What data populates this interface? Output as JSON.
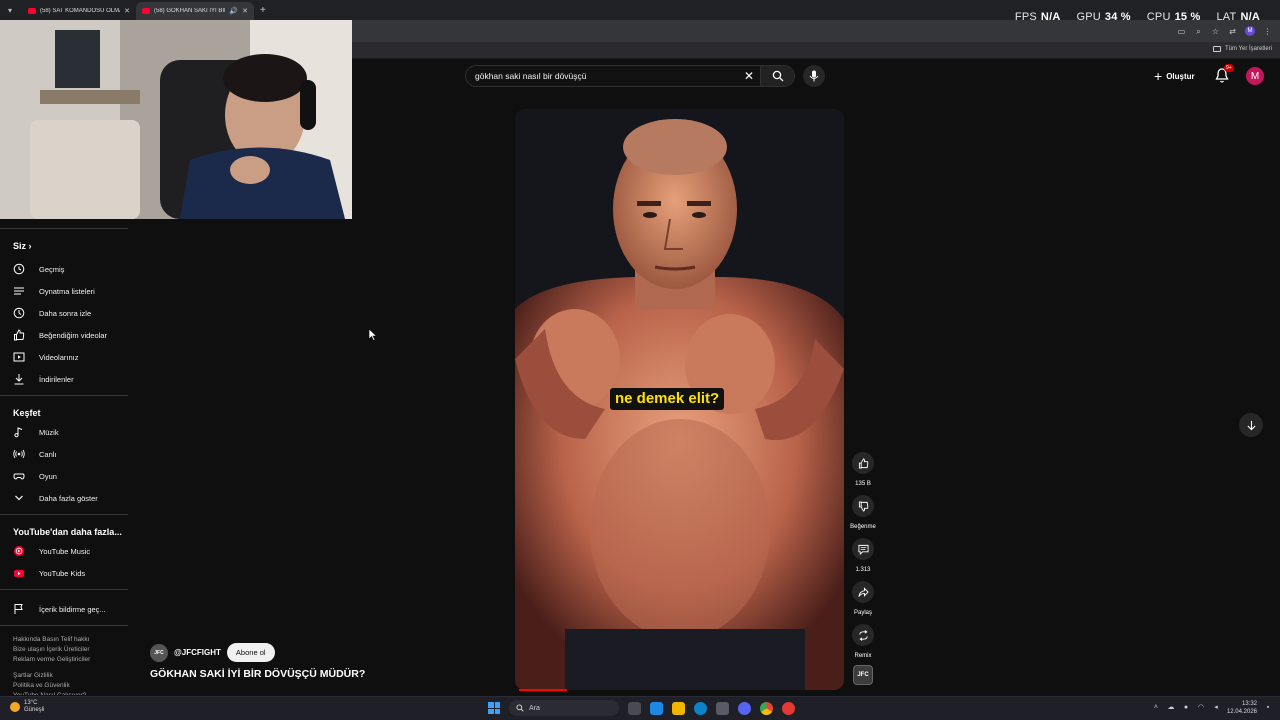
{
  "browser": {
    "tabs": [
      {
        "title": "(58) SAT KOMANDOSU OLMAK",
        "active": false
      },
      {
        "title": "(58) GÖKHAN SAKİ İYİ BİR D",
        "active": true
      }
    ],
    "bookmarks_all_label": "Tüm Yer İşaretleri",
    "profile_initial": "M"
  },
  "overlay": {
    "fps_label": "FPS",
    "fps_value": "N/A",
    "gpu_label": "GPU",
    "gpu_value": "34 %",
    "cpu_label": "CPU",
    "cpu_value": "15 %",
    "lat_label": "LAT",
    "lat_value": "N/A"
  },
  "header": {
    "search_value": "gökhan saki nasıl bir dövüşçü",
    "create_label": "Oluştur",
    "notification_badge": "9+",
    "avatar_initial": "M"
  },
  "sidebar": {
    "you_title": "Siz",
    "you_items": [
      {
        "label": "Geçmiş",
        "icon": "history-icon"
      },
      {
        "label": "Oynatma listeleri",
        "icon": "playlist-icon"
      },
      {
        "label": "Daha sonra izle",
        "icon": "clock-icon"
      },
      {
        "label": "Beğendiğim videolar",
        "icon": "like-icon"
      },
      {
        "label": "Videolarınız",
        "icon": "video-icon"
      },
      {
        "label": "İndirilenler",
        "icon": "download-icon"
      }
    ],
    "explore_title": "Keşfet",
    "explore_items": [
      {
        "label": "Müzik",
        "icon": "music-icon"
      },
      {
        "label": "Canlı",
        "icon": "live-icon"
      },
      {
        "label": "Oyun",
        "icon": "gaming-icon"
      },
      {
        "label": "Daha fazla göster",
        "icon": "chevron-down-icon"
      }
    ],
    "more_title": "YouTube'dan daha fazla...",
    "more_items": [
      {
        "label": "YouTube Music",
        "icon": "youtube-music-icon"
      },
      {
        "label": "YouTube Kids",
        "icon": "youtube-kids-icon"
      }
    ],
    "report_label": "İçerik bildirme geç...",
    "footer_lines": [
      "Hakkında  Basın  Telif hakkı",
      "Bize ulaşın  İçerik Üreticiler",
      "Reklam verme  Geliştiriciler",
      "",
      "Şartlar  Gizlilik",
      "Politika ve Güvenlik",
      "YouTube Nasıl Çalışıyor?"
    ]
  },
  "short": {
    "caption": "ne demek elit?",
    "progress_fraction": 0.15,
    "likes": "135 B",
    "dislike_label": "Beğenme",
    "comments": "1.313",
    "share_label": "Paylaş",
    "remix_label": "Remix",
    "channel_handle": "@JFCFIGHT",
    "channel_avatar_text": "JFC",
    "subscribe_label": "Abone ol",
    "title": "GÖKHAN SAKİ İYİ BİR DÖVÜŞÇÜ MÜDÜR?"
  },
  "taskbar": {
    "weather_temp": "13°C",
    "weather_desc": "Güneşli",
    "search_placeholder": "Ara",
    "time": "13:32",
    "date": "12.04.2026"
  }
}
